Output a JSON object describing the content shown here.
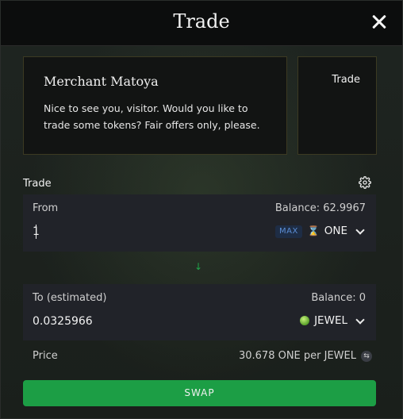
{
  "header": {
    "title": "Trade"
  },
  "merchant": {
    "name": "Merchant Matoya",
    "message": "Nice to see you, visitor. Would you like to trade some tokens? Fair offers only, please.",
    "portrait_label": "Trade"
  },
  "trade": {
    "section_label": "Trade",
    "from": {
      "label": "From",
      "balance": "Balance: 62.9967",
      "amount": "1",
      "max_label": "MAX",
      "token": "ONE"
    },
    "to": {
      "label": "To (estimated)",
      "balance": "Balance: 0",
      "amount": "0.0325966",
      "token": "JEWEL"
    },
    "price_label": "Price",
    "price_value": "30.678 ONE per JEWEL",
    "swap_label": "SWAP"
  },
  "colors": {
    "accent_green": "#1c9e45",
    "panel_bg": "#212329",
    "header_bg": "#0c0d0d"
  },
  "icons": {
    "close": "close-icon",
    "settings": "gear-icon",
    "one_token": "one-token-icon",
    "jewel_token": "jewel-token-icon",
    "arrow": "arrow-down-icon",
    "swap_rate": "swap-rate-icon"
  }
}
